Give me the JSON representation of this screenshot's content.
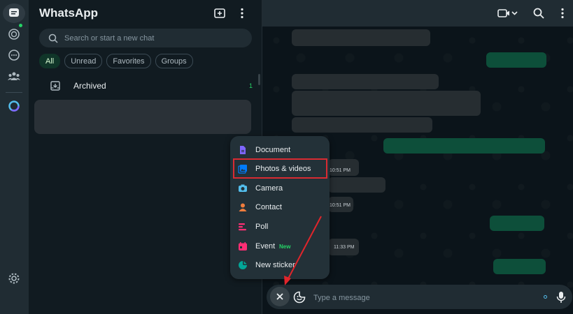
{
  "rail": {
    "icons": [
      "chats-icon",
      "status-icon",
      "channels-icon",
      "communities-icon",
      "meta-ai-icon",
      "settings-icon"
    ]
  },
  "sidebar": {
    "title": "WhatsApp",
    "search_placeholder": "Search or start a new chat",
    "filters": [
      "All",
      "Unread",
      "Favorites",
      "Groups"
    ],
    "active_filter": "All",
    "archived": {
      "label": "Archived",
      "count": "1"
    }
  },
  "conversation": {
    "timestamps": [
      "10:51 PM",
      "10:51 PM",
      "11:33 PM"
    ]
  },
  "composer": {
    "placeholder": "Type a message"
  },
  "attach_menu": {
    "items": [
      {
        "label": "Document",
        "icon": "document-icon",
        "color": "#7f66ff"
      },
      {
        "label": "Photos & videos",
        "icon": "photos-videos-icon",
        "color": "#007bfc"
      },
      {
        "label": "Camera",
        "icon": "camera-icon",
        "color": "#ff2e74"
      },
      {
        "label": "Contact",
        "icon": "contact-icon",
        "color": "#f07d3d"
      },
      {
        "label": "Poll",
        "icon": "poll-icon",
        "color": "#ffbc38"
      },
      {
        "label": "Event",
        "icon": "event-icon",
        "color": "#ff2e74",
        "badge": "New"
      },
      {
        "label": "New sticker",
        "icon": "new-sticker-icon",
        "color": "#02a698"
      }
    ],
    "highlighted": "Photos & videos"
  },
  "colors": {
    "accent": "#25d366",
    "outgoing_bubble": "#0d4f3a",
    "highlight_box": "#d92b32",
    "annotation_arrow": "#e0252b"
  }
}
